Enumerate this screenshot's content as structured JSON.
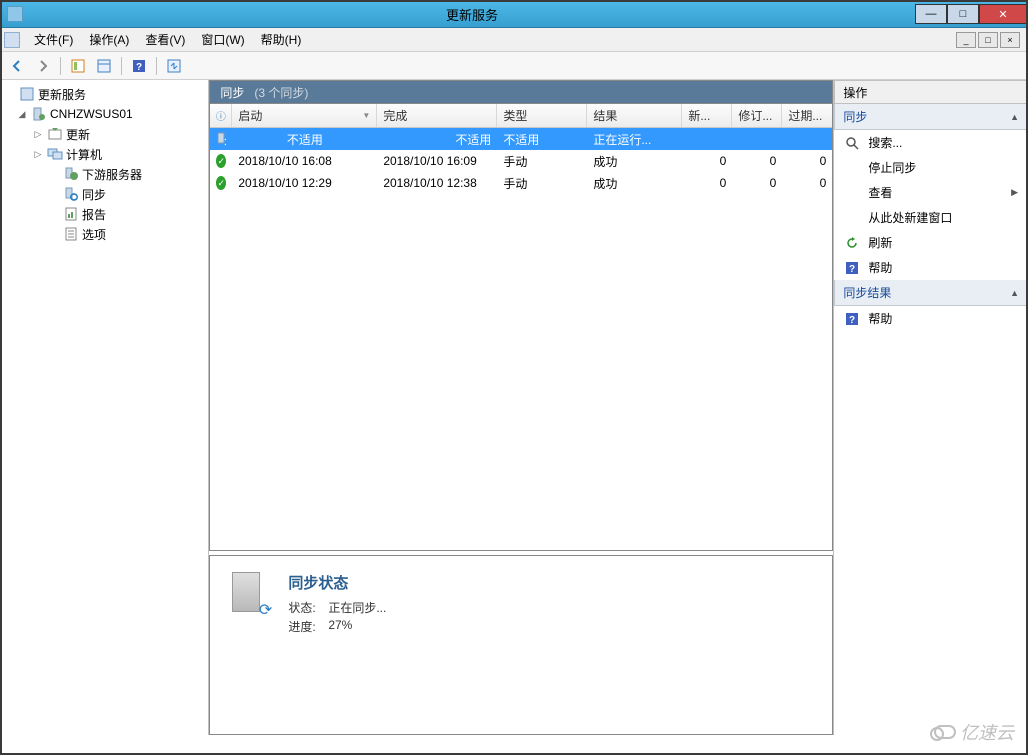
{
  "window": {
    "title": "更新服务"
  },
  "menu": {
    "file": "文件(F)",
    "action": "操作(A)",
    "view": "查看(V)",
    "window": "窗口(W)",
    "help": "帮助(H)"
  },
  "tree": {
    "root": "更新服务",
    "server": "CNHZWSUS01",
    "updates": "更新",
    "computers": "计算机",
    "downstream": "下游服务器",
    "sync": "同步",
    "reports": "报告",
    "options": "选项"
  },
  "center": {
    "title": "同步",
    "count": "(3 个同步)",
    "columns": {
      "start": "启动",
      "end": "完成",
      "type": "类型",
      "result": "结果",
      "new": "新...",
      "rev": "修订...",
      "exp": "过期..."
    },
    "rows": [
      {
        "selected": true,
        "icon": "sync",
        "start": "不适用",
        "end": "不适用",
        "type": "不适用",
        "result": "正在运行...",
        "new": "",
        "rev": "",
        "exp": ""
      },
      {
        "selected": false,
        "icon": "ok",
        "start": "2018/10/10 16:08",
        "end": "2018/10/10 16:09",
        "type": "手动",
        "result": "成功",
        "new": "0",
        "rev": "0",
        "exp": "0"
      },
      {
        "selected": false,
        "icon": "ok",
        "start": "2018/10/10 12:29",
        "end": "2018/10/10 12:38",
        "type": "手动",
        "result": "成功",
        "new": "0",
        "rev": "0",
        "exp": "0"
      }
    ]
  },
  "detail": {
    "title": "同步状态",
    "state_label": "状态:",
    "state_value": "正在同步...",
    "progress_label": "进度:",
    "progress_value": "27%"
  },
  "actions": {
    "header": "操作",
    "section1": "同步",
    "search": "搜索...",
    "stop_sync": "停止同步",
    "view": "查看",
    "new_window": "从此处新建窗口",
    "refresh": "刷新",
    "help": "帮助",
    "section2": "同步结果",
    "help2": "帮助"
  },
  "watermark": "亿速云"
}
